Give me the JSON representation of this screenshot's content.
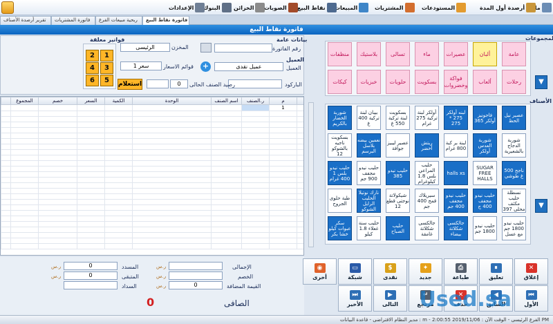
{
  "menu": {
    "items": [
      {
        "label": "ملف",
        "icon": "file-icon",
        "color": "#6b8db5"
      },
      {
        "label": "أرصدة أول المدة",
        "icon": "opening-balance-icon",
        "color": "#c9963a"
      },
      {
        "label": "المستودعات",
        "icon": "warehouse-icon",
        "color": "#e39b2f"
      },
      {
        "label": "المشتريات",
        "icon": "cart-icon",
        "color": "#d36e2f"
      },
      {
        "label": "المبيعات",
        "icon": "sales-icon",
        "color": "#3f86c8"
      },
      {
        "label": "نقاط البيع",
        "icon": "pos-icon",
        "color": "#4e6a8f"
      },
      {
        "label": "الصوبات",
        "icon": "cabinet-icon",
        "color": "#a34b2a"
      },
      {
        "label": "الخزائن",
        "icon": "safe-icon",
        "color": "#8b8b8b"
      },
      {
        "label": "البنوك",
        "icon": "bank-icon",
        "color": "#5f6f86"
      },
      {
        "label": "الإعدادات",
        "icon": "settings-icon",
        "color": "#6f7f95"
      }
    ]
  },
  "tabs": [
    {
      "label": "فاتورة نقاط البيع",
      "active": true
    },
    {
      "label": "ربحية مبيعات الفرع",
      "active": false
    },
    {
      "label": "فاتورة المشتريات",
      "active": false
    },
    {
      "label": "تقرير أرصدة الأصناف",
      "active": false
    }
  ],
  "title": "فاتورة نقاط البيع",
  "header": {
    "general_data_label": "بيانات عامة",
    "invoice_no_label": "رقم الفاتورة",
    "invoice_no": "",
    "store_label": "المخزن",
    "store_value": "الرئيسى",
    "customer_section_label": "العميل",
    "customer_label": "العميل",
    "customer_value": "عميل نقدى",
    "price_list_label": "قوائم الاسعار",
    "price_list_value": "سعر 1",
    "barcode_label": "الباركود",
    "barcode_value": "",
    "current_item_balance_label": "رصيد الصنف الحالى",
    "current_item_balance": "0",
    "inquiry_button": "استعلام",
    "suspended_invoices_label": "فواتير معلقة",
    "numbers": [
      "1",
      "2",
      "3",
      "4",
      "5",
      "6"
    ]
  },
  "grid": {
    "columns": [
      "م",
      "ر.الصنف",
      "اسم الصنف",
      "الوحدة",
      "الكمية",
      "السعر",
      "خصم",
      "المجموع"
    ],
    "first_row_index": "1"
  },
  "totals": {
    "total_label": "الإجمالى",
    "discount_label": "الخصم",
    "vat_label": "القيمة المضافة",
    "vat_value": "0",
    "net_label": "الصافى",
    "net_value": "0",
    "paid_label": "المسدد",
    "paid_value": "0",
    "remaining_label": "المتبقى",
    "remaining_value": "0",
    "payment_label": "السداد",
    "currency": "ر.س"
  },
  "groups_label": "المجموعات",
  "items_label": "الأصناف",
  "groups_row1": [
    "عامة",
    "ألبان",
    "عصيرات",
    "ماء",
    "تسالى",
    "بلاستيك",
    "منظفات"
  ],
  "groups_row2": [
    "رحلات",
    "ألعاب",
    "فواكة وخضروات",
    "بسكويت",
    "حلويات",
    "خبزيات",
    "كيكات"
  ],
  "items_rows": [
    [
      {
        "t": "عصير نيل الحظ",
        "c": "blue"
      },
      {
        "t": "فاجونيز أولكر 365",
        "c": "blue"
      },
      {
        "t": "لبنه أولكر 275 * 275",
        "c": "blue"
      },
      {
        "t": "أولكر لبنة تركية 275 غرام",
        "c": "white"
      },
      {
        "t": "بسكويت لبنة تركية 550 غ",
        "c": "white"
      },
      {
        "t": "بيبان لبنة تركية 400 غ",
        "c": "white"
      },
      {
        "t": "شوربة الخضار بالكريم",
        "c": "blue"
      }
    ],
    [
      {
        "t": "شوربة الدجاج بالشعيرية",
        "c": "white"
      },
      {
        "t": "شوربة العدس أولكر",
        "c": "blue"
      },
      {
        "t": "لبنة بر كبة 800 غرام",
        "c": "white"
      },
      {
        "t": "ريتش أخضر",
        "c": "blue"
      },
      {
        "t": "عصير ليبيز جوافة",
        "c": "white"
      },
      {
        "t": "نعمين بيضه بلاسل البرسم",
        "c": "blue"
      },
      {
        "t": "بسكويت ناجيه بالشوكو 12",
        "c": "white"
      }
    ],
    [
      {
        "t": "ناجح 500 غ طوشي",
        "c": "blue"
      },
      {
        "t": "SUGAR FREE HALLS",
        "c": "white"
      },
      {
        "t": "halls xs",
        "c": "blue"
      },
      {
        "t": "حليب المراعي بلس 1.8 كيلوغرام",
        "c": "white"
      },
      {
        "t": "حليب نيدو 385",
        "c": "blue"
      },
      {
        "t": "حليب نيدو مجفف 900 جم",
        "c": "white"
      },
      {
        "t": "حليب نيدو بلس 1 400 غرام",
        "c": "blue"
      }
    ],
    [
      {
        "t": "نسطلة حليب مكثف محلى 397",
        "c": "white"
      },
      {
        "t": "حليب نيدو مجفف 400 ج",
        "c": "blue"
      },
      {
        "t": "حليب نيدو مجفف 400 جم",
        "c": "blue"
      },
      {
        "t": "سيريلاك قمح 400 جم",
        "c": "white"
      },
      {
        "t": "شيكولاتة نوجتى قطع 12",
        "c": "white"
      },
      {
        "t": "نارك نوتيلا الحليب الرايل الشوكو",
        "c": "blue"
      },
      {
        "t": "طبة حلوى الجروح",
        "c": "white"
      }
    ],
    [
      {
        "t": "حليب نيدو 1800 جم مع عسل",
        "c": "white"
      },
      {
        "t": "حليب نيدو 1800 جم",
        "c": "white"
      },
      {
        "t": "جالكسى شكلاتة بيضاء",
        "c": "blue"
      },
      {
        "t": "جالكسى شكلاتة غامقة",
        "c": "white"
      },
      {
        "t": "حليب الصباح",
        "c": "blue"
      },
      {
        "t": "حليب سنة غعلاء 1.8 كيلو",
        "c": "white"
      },
      {
        "t": "سكر عبوات كيلو خشا بكر",
        "c": "blue"
      }
    ]
  ],
  "actions_row1": [
    {
      "label": "إغلاق",
      "icon": "close-icon",
      "color": "#d9322a",
      "glyph": "✕"
    },
    {
      "label": "تعليق",
      "icon": "pause-icon",
      "color": "#2e6fb5",
      "glyph": "⏸"
    },
    {
      "label": "طباعة",
      "icon": "printer-icon",
      "color": "#555f6d",
      "glyph": "⎙"
    },
    {
      "label": "جديد",
      "icon": "new-icon",
      "color": "#e6a11a",
      "glyph": "✦"
    },
    {
      "label": "نقدى",
      "icon": "cash-icon",
      "color": "#d9a11a",
      "glyph": "$"
    },
    {
      "label": "شبكة",
      "icon": "card-icon",
      "color": "#2a5aa8",
      "glyph": "▭"
    },
    {
      "label": "أخرى",
      "icon": "other-payment-icon",
      "color": "#e0622a",
      "glyph": "◉"
    }
  ],
  "actions_row2": [
    {
      "label": "الأول",
      "icon": "first-icon",
      "color": "#2e6fb5",
      "glyph": "⏮"
    },
    {
      "label": "السابق",
      "icon": "previous-icon",
      "color": "#2e6fb5",
      "glyph": "◀"
    },
    {
      "label": "حذف",
      "icon": "delete-icon",
      "color": "#d9322a",
      "glyph": "✕"
    },
    {
      "label": "مرتجع",
      "icon": "return-icon",
      "color": "#555f6d",
      "glyph": "↵"
    },
    {
      "label": "التالى",
      "icon": "next-icon",
      "color": "#2e6fb5",
      "glyph": "▶"
    },
    {
      "label": "الأخير",
      "icon": "last-icon",
      "color": "#2e6fb5",
      "glyph": "⏭"
    }
  ],
  "status": "مدير النظام الافتراضى - قاعدة البيانات : m - الفرع الرئيسى - الوقت الآن : 2019/11/06 2:00:55 PM",
  "watermark": "Used.sa"
}
